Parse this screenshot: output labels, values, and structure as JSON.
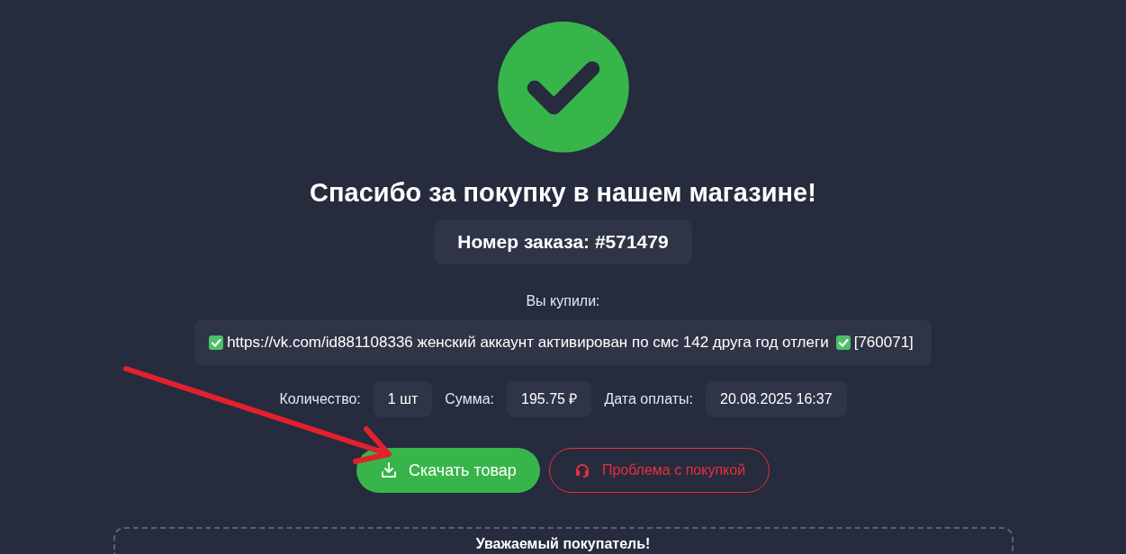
{
  "title": "Спасибо за покупку в нашем магазине!",
  "order_number": "Номер заказа: #571479",
  "purchased_label": "Вы купили:",
  "product": {
    "parts": [
      {
        "kind": "check"
      },
      {
        "kind": "text",
        "text": "https://vk.com/id881108336 женский аккаунт активирован по смс 142 друга год отлеги"
      },
      {
        "kind": "check"
      },
      {
        "kind": "text",
        "text": "[760071]"
      }
    ]
  },
  "details": [
    {
      "label": "Количество:",
      "value": "1 шт"
    },
    {
      "label": "Сумма:",
      "value": "195.75 ₽"
    },
    {
      "label": "Дата оплаты:",
      "value": "20.08.2025 16:37"
    }
  ],
  "buttons": [
    {
      "kind": "primary",
      "label": "Скачать товар"
    },
    {
      "kind": "problem",
      "label": "Проблема с покупкой"
    }
  ],
  "notice": {
    "heading": "Уважаемый покупатель!"
  }
}
